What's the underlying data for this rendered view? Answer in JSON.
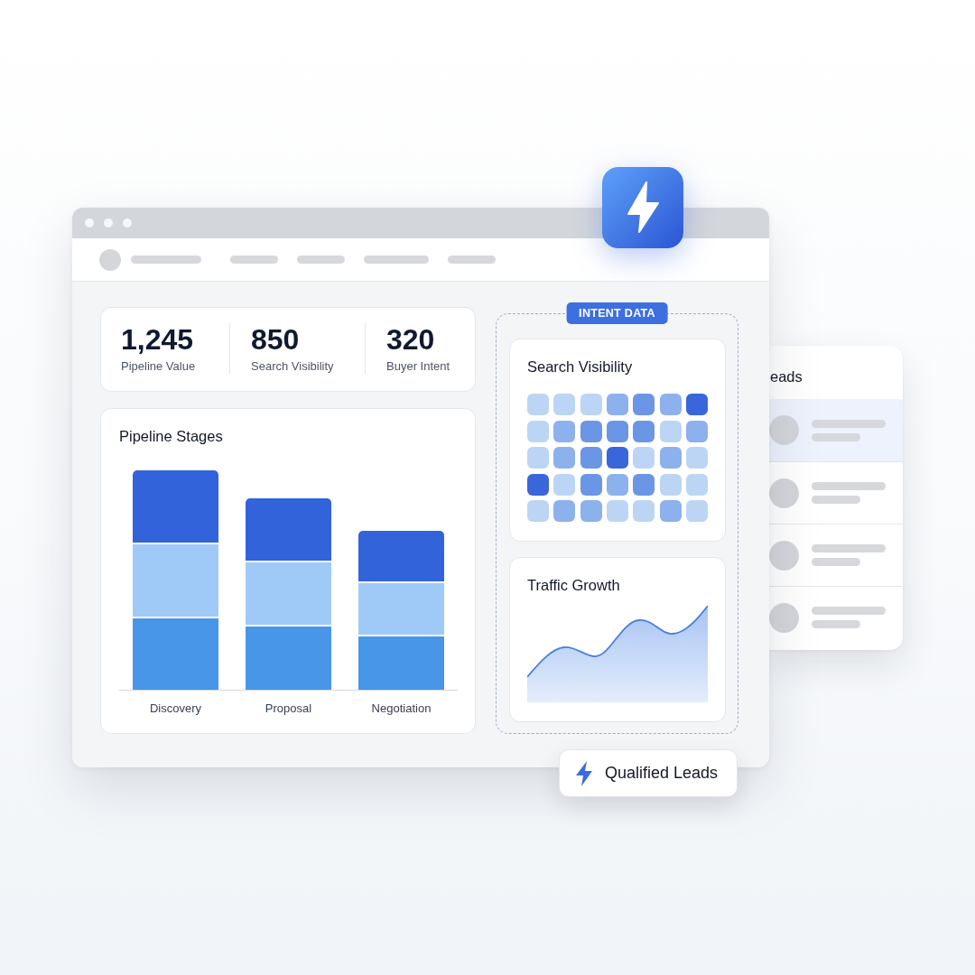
{
  "stats": [
    {
      "value": "1,245",
      "label": "Pipeline Value"
    },
    {
      "value": "850",
      "label": "Search Visibility"
    },
    {
      "value": "320",
      "label": "Buyer Intent"
    }
  ],
  "pipeline_stages": {
    "title": "Pipeline Stages",
    "stages": [
      {
        "label": "Discovery"
      },
      {
        "label": "Proposal"
      },
      {
        "label": "Negotiation"
      }
    ]
  },
  "intent_data": {
    "badge": "INTENT DATA",
    "search_visibility": {
      "title": "Search Visibility",
      "grid": [
        [
          {
            "color": "#bcd5f5"
          },
          {
            "color": "#bcd5f5"
          },
          {
            "color": "#bcd5f5"
          },
          {
            "color": "#8cb1ed"
          },
          {
            "color": "#6b95e5"
          },
          {
            "color": "#8cb1ed"
          },
          {
            "color": "#3a66db"
          }
        ],
        [
          {
            "color": "#bcd5f5"
          },
          {
            "color": "#8cb1ed"
          },
          {
            "color": "#6b95e5"
          },
          {
            "color": "#6b95e5"
          },
          {
            "color": "#6b95e5"
          },
          {
            "color": "#bcd5f5"
          },
          {
            "color": "#8cb1ed"
          }
        ],
        [
          {
            "color": "#bcd5f5"
          },
          {
            "color": "#8cb1ed"
          },
          {
            "color": "#6b95e5"
          },
          {
            "color": "#3a66db"
          },
          {
            "color": "#bcd5f5"
          },
          {
            "color": "#8cb1ed"
          },
          {
            "color": "#bcd5f5"
          }
        ],
        [
          {
            "color": "#3a66db"
          },
          {
            "color": "#bcd5f5"
          },
          {
            "color": "#6b95e5"
          },
          {
            "color": "#8cb1ed"
          },
          {
            "color": "#6b95e5"
          },
          {
            "color": "#bcd5f5"
          },
          {
            "color": "#bcd5f5"
          }
        ],
        [
          {
            "color": "#bcd5f5"
          },
          {
            "color": "#8cb1ed"
          },
          {
            "color": "#8cb1ed"
          },
          {
            "color": "#bcd5f5"
          },
          {
            "color": "#bcd5f5"
          },
          {
            "color": "#8cb1ed"
          },
          {
            "color": "#bcd5f5"
          }
        ]
      ]
    },
    "traffic_growth": {
      "title": "Traffic Growth"
    }
  },
  "leads": {
    "title": "eads",
    "rows": [
      {
        "selected": true
      },
      {
        "selected": false
      },
      {
        "selected": false
      },
      {
        "selected": false
      }
    ]
  },
  "qualified_leads": {
    "label": "Qualified Leads"
  }
}
